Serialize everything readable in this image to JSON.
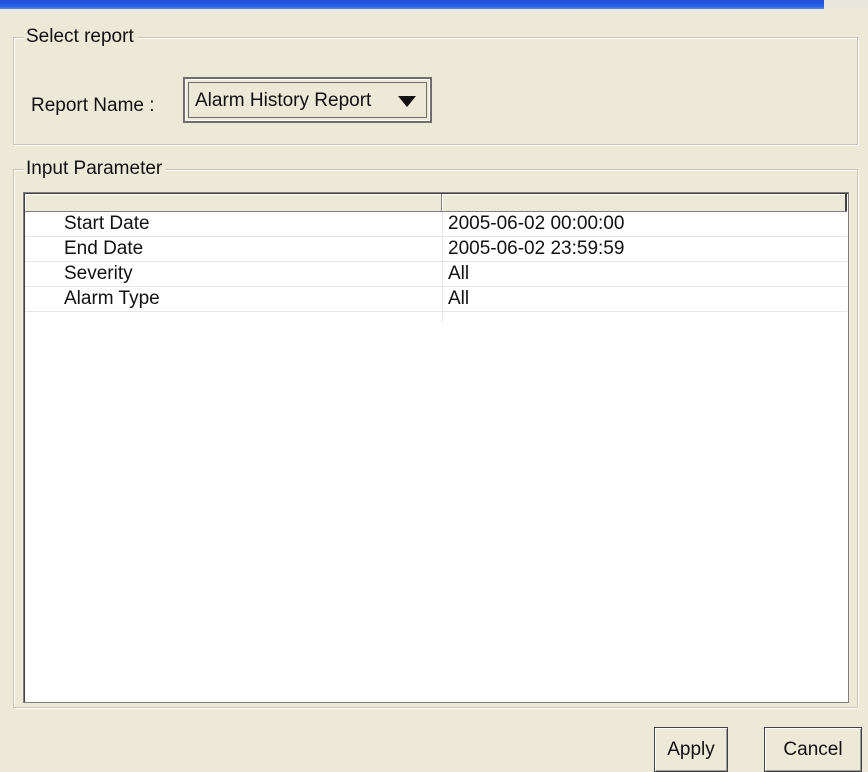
{
  "select_report": {
    "title": "Select report",
    "report_name_label": "Report Name :",
    "report_name_value": "Alarm History Report"
  },
  "input_parameter": {
    "title": "Input Parameter",
    "columns": [
      "",
      ""
    ],
    "rows": [
      {
        "name": "Start Date",
        "value": "2005-06-02 00:00:00"
      },
      {
        "name": "End Date",
        "value": "2005-06-02 23:59:59"
      },
      {
        "name": "Severity",
        "value": "All"
      },
      {
        "name": "Alarm Type",
        "value": "All"
      }
    ]
  },
  "buttons": {
    "apply": "Apply",
    "cancel": "Cancel"
  },
  "icons": {
    "combo_arrow": "chevron-down-icon"
  }
}
